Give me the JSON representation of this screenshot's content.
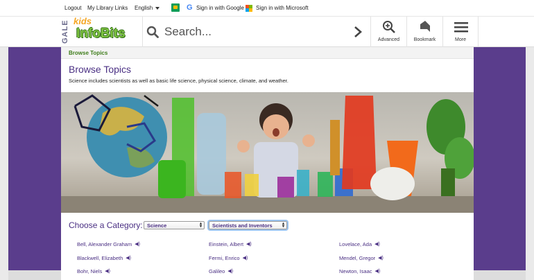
{
  "topbar": {
    "logout": "Logout",
    "my_library_links": "My Library Links",
    "language": "English",
    "sign_in_google": "Sign in with Google",
    "sign_in_microsoft": "Sign in with Microsoft"
  },
  "header": {
    "brand_vertical": "GALE",
    "brand_kids": "kids",
    "brand_name": "InfoBits",
    "search_placeholder": "Search...",
    "advanced_label": "Advanced",
    "bookmark_label": "Bookmark",
    "more_label": "More"
  },
  "breadcrumb": "Browse Topics",
  "page": {
    "title": "Browse Topics",
    "description": "Science includes scientists as well as basic life science, physical science, climate, and weather."
  },
  "category": {
    "label": "Choose a Category:",
    "subject_selected": "Science",
    "topic_selected": "Scientists and Inventors"
  },
  "topics": [
    [
      "Bell, Alexander Graham",
      "Blackwell, Elizabeth",
      "Bohr, Niels"
    ],
    [
      "Einstein, Albert",
      "Fermi, Enrico",
      "Galileo"
    ],
    [
      "Lovelace, Ada",
      "Mendel, Gregor",
      "Newton, Isaac"
    ]
  ],
  "colors": {
    "frame_purple": "#5a3d8c",
    "title_purple": "#4a2f83",
    "breadcrumb_green": "#3f7d1b",
    "logo_green": "#7dc241",
    "logo_orange": "#f5a623"
  },
  "icons": [
    "google-classroom-icon",
    "google-icon",
    "microsoft-icon",
    "search-icon",
    "chevron-right-icon",
    "advanced-search-icon",
    "bookmark-icon",
    "menu-icon",
    "speaker-icon"
  ]
}
